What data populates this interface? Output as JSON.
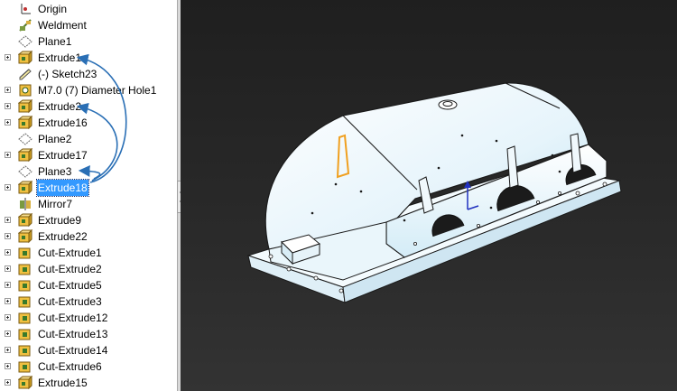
{
  "feature_tree": {
    "items": [
      {
        "label": "Origin",
        "icon": "origin-icon",
        "expandable": false,
        "selected": false
      },
      {
        "label": "Weldment",
        "icon": "weldment-icon",
        "expandable": false,
        "selected": false
      },
      {
        "label": "Plane1",
        "icon": "plane-icon",
        "expandable": false,
        "selected": false
      },
      {
        "label": "Extrude1",
        "icon": "extrude-icon",
        "expandable": true,
        "selected": false
      },
      {
        "label": "(-) Sketch23",
        "icon": "sketch-icon",
        "expandable": false,
        "selected": false
      },
      {
        "label": "M7.0 (7) Diameter Hole1",
        "icon": "hole-icon",
        "expandable": true,
        "selected": false
      },
      {
        "label": "Extrude2",
        "icon": "extrude-icon",
        "expandable": true,
        "selected": false
      },
      {
        "label": "Extrude16",
        "icon": "extrude-icon",
        "expandable": true,
        "selected": false
      },
      {
        "label": "Plane2",
        "icon": "plane-icon",
        "expandable": false,
        "selected": false
      },
      {
        "label": "Extrude17",
        "icon": "extrude-icon",
        "expandable": true,
        "selected": false
      },
      {
        "label": "Plane3",
        "icon": "plane-icon",
        "expandable": false,
        "selected": false
      },
      {
        "label": "Extrude18",
        "icon": "extrude-icon",
        "expandable": true,
        "selected": true
      },
      {
        "label": "Mirror7",
        "icon": "mirror-icon",
        "expandable": false,
        "selected": false
      },
      {
        "label": "Extrude9",
        "icon": "extrude-icon",
        "expandable": true,
        "selected": false
      },
      {
        "label": "Extrude22",
        "icon": "extrude-icon",
        "expandable": true,
        "selected": false
      },
      {
        "label": "Cut-Extrude1",
        "icon": "cut-extrude-icon",
        "expandable": true,
        "selected": false
      },
      {
        "label": "Cut-Extrude2",
        "icon": "cut-extrude-icon",
        "expandable": true,
        "selected": false
      },
      {
        "label": "Cut-Extrude5",
        "icon": "cut-extrude-icon",
        "expandable": true,
        "selected": false
      },
      {
        "label": "Cut-Extrude3",
        "icon": "cut-extrude-icon",
        "expandable": true,
        "selected": false
      },
      {
        "label": "Cut-Extrude12",
        "icon": "cut-extrude-icon",
        "expandable": true,
        "selected": false
      },
      {
        "label": "Cut-Extrude13",
        "icon": "cut-extrude-icon",
        "expandable": true,
        "selected": false
      },
      {
        "label": "Cut-Extrude14",
        "icon": "cut-extrude-icon",
        "expandable": true,
        "selected": false
      },
      {
        "label": "Cut-Extrude6",
        "icon": "cut-extrude-icon",
        "expandable": true,
        "selected": false
      },
      {
        "label": "Extrude15",
        "icon": "extrude-icon",
        "expandable": true,
        "selected": false
      }
    ]
  },
  "colors": {
    "selection": "#3399ff",
    "annotation_arrow": "#2a6fb5",
    "viewport_bg": "#2a2a2a",
    "model_fill": "#e8f6fc",
    "highlight_edge": "#f0a020"
  },
  "viewport": {
    "model": "weldment-housing"
  }
}
